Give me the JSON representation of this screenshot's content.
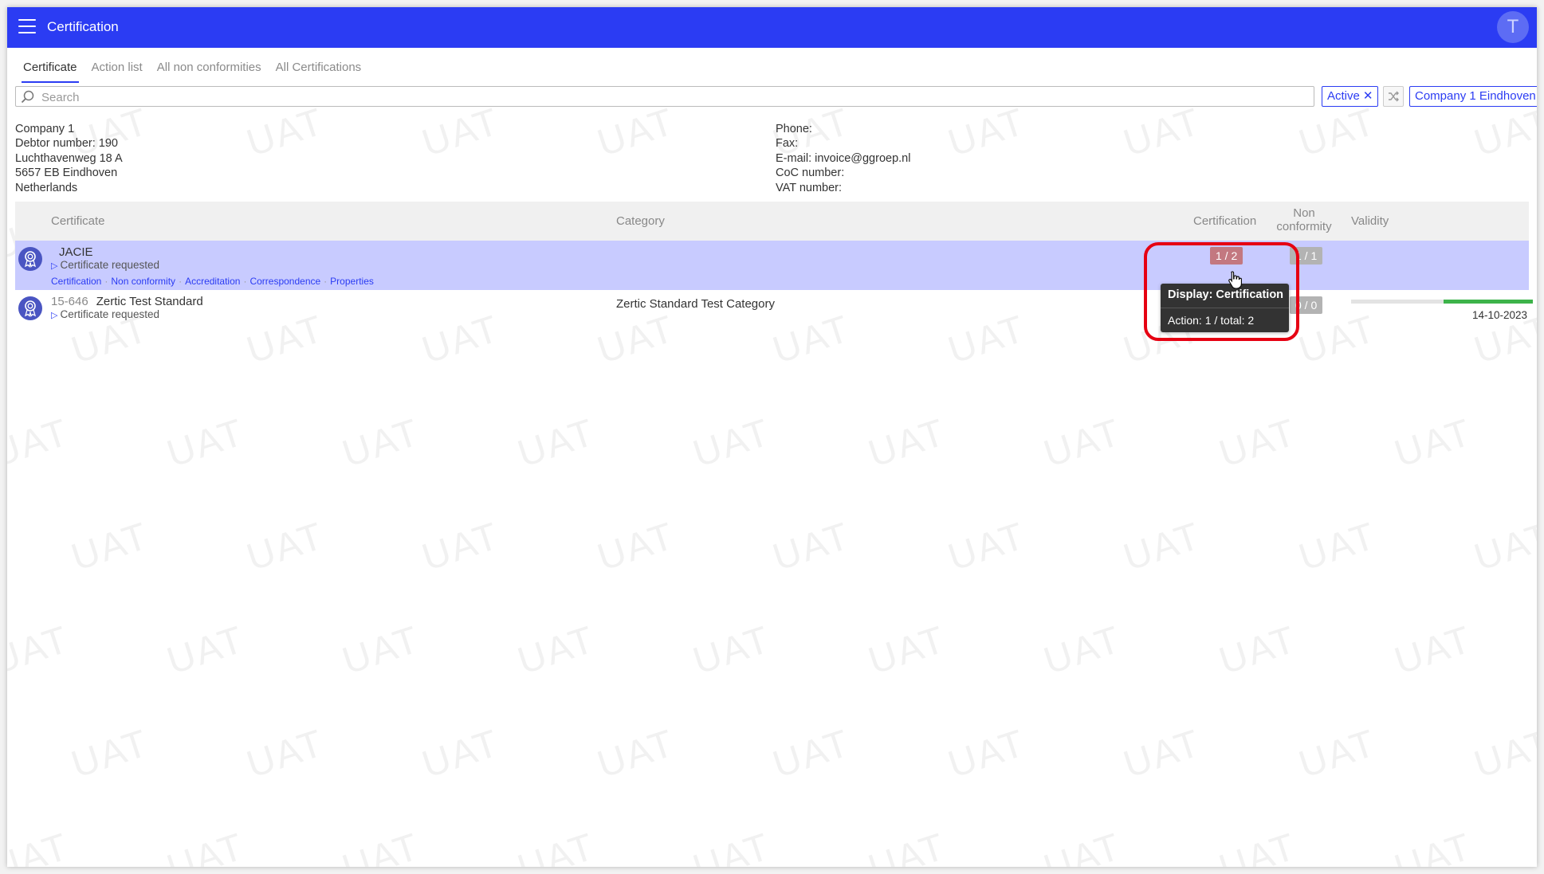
{
  "app": {
    "title": "Certification",
    "avatar_initial": "T",
    "brand_color": "#2b3cf3"
  },
  "tabs": [
    {
      "label": "Certificate",
      "active": true
    },
    {
      "label": "Action list",
      "active": false
    },
    {
      "label": "All non conformities",
      "active": false
    },
    {
      "label": "All Certifications",
      "active": false
    }
  ],
  "search": {
    "placeholder": "Search",
    "value": ""
  },
  "filters": {
    "active_label": "Active",
    "remove_symbol": "✕",
    "company_label": "Company 1 Eindhoven"
  },
  "company": {
    "name": "Company 1",
    "debtor": "Debtor number: 190",
    "street": "Luchthavenweg 18 A",
    "city": "5657 EB Eindhoven",
    "country": "Netherlands",
    "phone": "Phone:",
    "fax": "Fax:",
    "email": "E-mail: invoice@ggroep.nl",
    "coc": "CoC number:",
    "vat": "VAT number:"
  },
  "table": {
    "headers": {
      "certificate": "Certificate",
      "category": "Category",
      "certification": "Certification",
      "non_conformity_line1": "Non",
      "non_conformity_line2": "conformity",
      "validity": "Validity"
    },
    "rows": [
      {
        "code": "",
        "name": "JACIE",
        "status": "Certificate requested",
        "links": [
          "Certification",
          "Non conformity",
          "Accreditation",
          "Correspondence",
          "Properties"
        ],
        "category": "",
        "certification": "1 / 2",
        "non_conformity": "1 / 1",
        "validity_date": "",
        "selected": true
      },
      {
        "code": "15-646",
        "name": "Zertic Test Standard",
        "status": "Certificate requested",
        "category": "Zertic Standard Test Category",
        "certification": "",
        "non_conformity": "0 / 0",
        "validity_fraction": 0.49,
        "validity_date": "14-10-2023",
        "selected": false
      }
    ]
  },
  "tooltip": {
    "title": "Display: Certification",
    "body": "Action: 1 / total: 2"
  },
  "watermark_text": "UAT",
  "colors": {
    "selected_row": "#c8cbff",
    "cert_badge": "#c37880",
    "nc_badge": "#b3b3b3",
    "validity_fill": "#3db34a",
    "highlight": "#e60012"
  }
}
